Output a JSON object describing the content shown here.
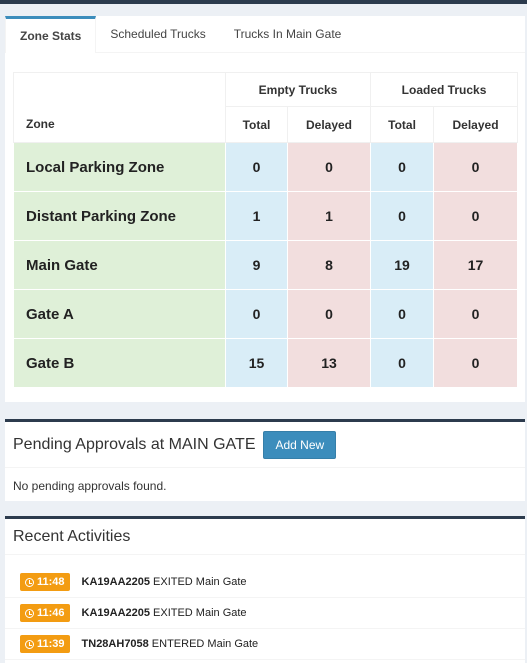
{
  "tabs": [
    {
      "label": "Zone Stats"
    },
    {
      "label": "Scheduled Trucks"
    },
    {
      "label": "Trucks In Main Gate"
    }
  ],
  "stats": {
    "group_empty": "Empty Trucks",
    "group_loaded": "Loaded Trucks",
    "col_zone": "Zone",
    "col_total": "Total",
    "col_delayed": "Delayed",
    "rows": [
      {
        "zone": "Local Parking Zone",
        "empty_total": "0",
        "empty_delayed": "0",
        "loaded_total": "0",
        "loaded_delayed": "0"
      },
      {
        "zone": "Distant Parking Zone",
        "empty_total": "1",
        "empty_delayed": "1",
        "loaded_total": "0",
        "loaded_delayed": "0"
      },
      {
        "zone": "Main Gate",
        "empty_total": "9",
        "empty_delayed": "8",
        "loaded_total": "19",
        "loaded_delayed": "17"
      },
      {
        "zone": "Gate A",
        "empty_total": "0",
        "empty_delayed": "0",
        "loaded_total": "0",
        "loaded_delayed": "0"
      },
      {
        "zone": "Gate B",
        "empty_total": "15",
        "empty_delayed": "13",
        "loaded_total": "0",
        "loaded_delayed": "0"
      }
    ]
  },
  "pending": {
    "title": "Pending Approvals at MAIN GATE",
    "add_label": "Add New",
    "empty_message": "No pending approvals found."
  },
  "activities": {
    "title": "Recent Activities",
    "items": [
      {
        "time": "11:48",
        "truck": "KA19AA2205",
        "event": "EXITED Main Gate"
      },
      {
        "time": "11:46",
        "truck": "KA19AA2205",
        "event": "EXITED Main Gate"
      },
      {
        "time": "11:39",
        "truck": "TN28AH7058",
        "event": "ENTERED Main Gate"
      }
    ]
  },
  "colors": {
    "accent": "#3c8dbc",
    "zone_bg": "#dff0d8",
    "empty_bg": "#d9edf7",
    "delayed_bg": "#f2dede",
    "badge": "#f39c12",
    "dark_bar": "#2c3b4d"
  },
  "icons": {
    "badge_icon": "clock-icon"
  }
}
